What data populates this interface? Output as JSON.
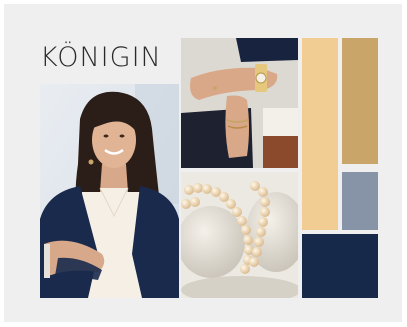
{
  "brand": {
    "name": "KÖNIGIN"
  },
  "palette": {
    "board_background": "#efefef",
    "sand": "#f1cd93",
    "gold": "#c9a56a",
    "slate": "#8794a8",
    "navy": "#17294b"
  },
  "photos": [
    {
      "subject": "woman-portrait"
    },
    {
      "subject": "wrist-jewelry"
    },
    {
      "subject": "pearl-necklace-on-stones"
    }
  ]
}
